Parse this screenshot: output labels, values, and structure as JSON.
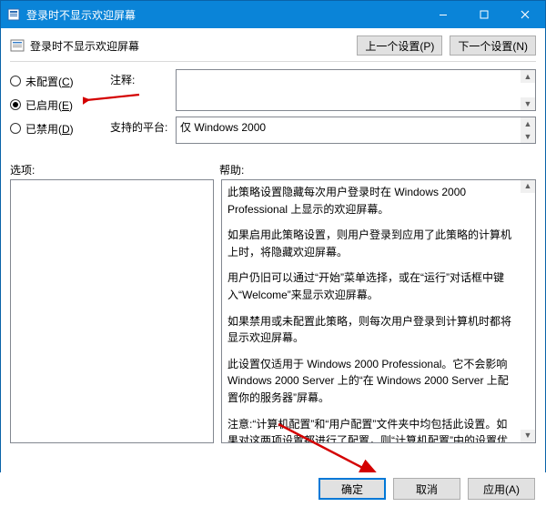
{
  "window": {
    "title": "登录时不显示欢迎屏幕"
  },
  "header": {
    "caption": "登录时不显示欢迎屏幕",
    "prev_btn": "上一个设置(P)",
    "next_btn": "下一个设置(N)"
  },
  "radios": {
    "not_configured": "未配置(C)",
    "enabled": "已启用(E)",
    "disabled": "已禁用(D)",
    "selected": "enabled"
  },
  "fields": {
    "comment_label": "注释:",
    "comment_value": "",
    "platform_label": "支持的平台:",
    "platform_value": "仅 Windows 2000"
  },
  "section_labels": {
    "options": "选项:",
    "help": "帮助:"
  },
  "help": {
    "p1": "此策略设置隐藏每次用户登录时在 Windows 2000 Professional 上显示的欢迎屏幕。",
    "p2": "如果启用此策略设置，则用户登录到应用了此策略的计算机上时，将隐藏欢迎屏幕。",
    "p3": "用户仍旧可以通过“开始”菜单选择，或在“运行”对话框中键入“Welcome”来显示欢迎屏幕。",
    "p4": "如果禁用或未配置此策略，则每次用户登录到计算机时都将显示欢迎屏幕。",
    "p5": "此设置仅适用于 Windows 2000 Professional。它不会影响 Windows 2000 Server 上的“在 Windows 2000 Server 上配置你的服务器”屏幕。",
    "p6": "注意:“计算机配置”和“用户配置”文件夹中均包括此设置。如果对这两项设置都进行了配置，则“计算机配置”中的设置优先于“用户配置”中的设置。"
  },
  "footer": {
    "ok": "确定",
    "cancel": "取消",
    "apply": "应用(A)"
  }
}
